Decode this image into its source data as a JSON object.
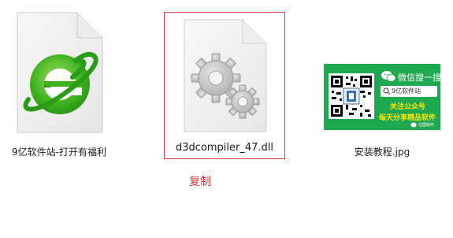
{
  "files": [
    {
      "name": "9亿软件站-打开有福利",
      "icon": "browser-shortcut-icon"
    },
    {
      "name": "d3dcompiler_47.dll",
      "icon": "dll-gear-file-icon",
      "selected": true
    },
    {
      "name": "安装教程.jpg",
      "icon": "image-thumbnail"
    }
  ],
  "annotation": {
    "copy_label": "复制",
    "color": "#d9363e"
  },
  "thumbnail": {
    "wechat_search": "微信搜一搜",
    "search_box_text": "9亿软件站",
    "follow_text": "关注公众号",
    "promo_text": "每天分享精品软件",
    "footer_text": "亿图软件",
    "colors": {
      "background": "#1ea84f",
      "promo_text": "#ffe600"
    }
  }
}
